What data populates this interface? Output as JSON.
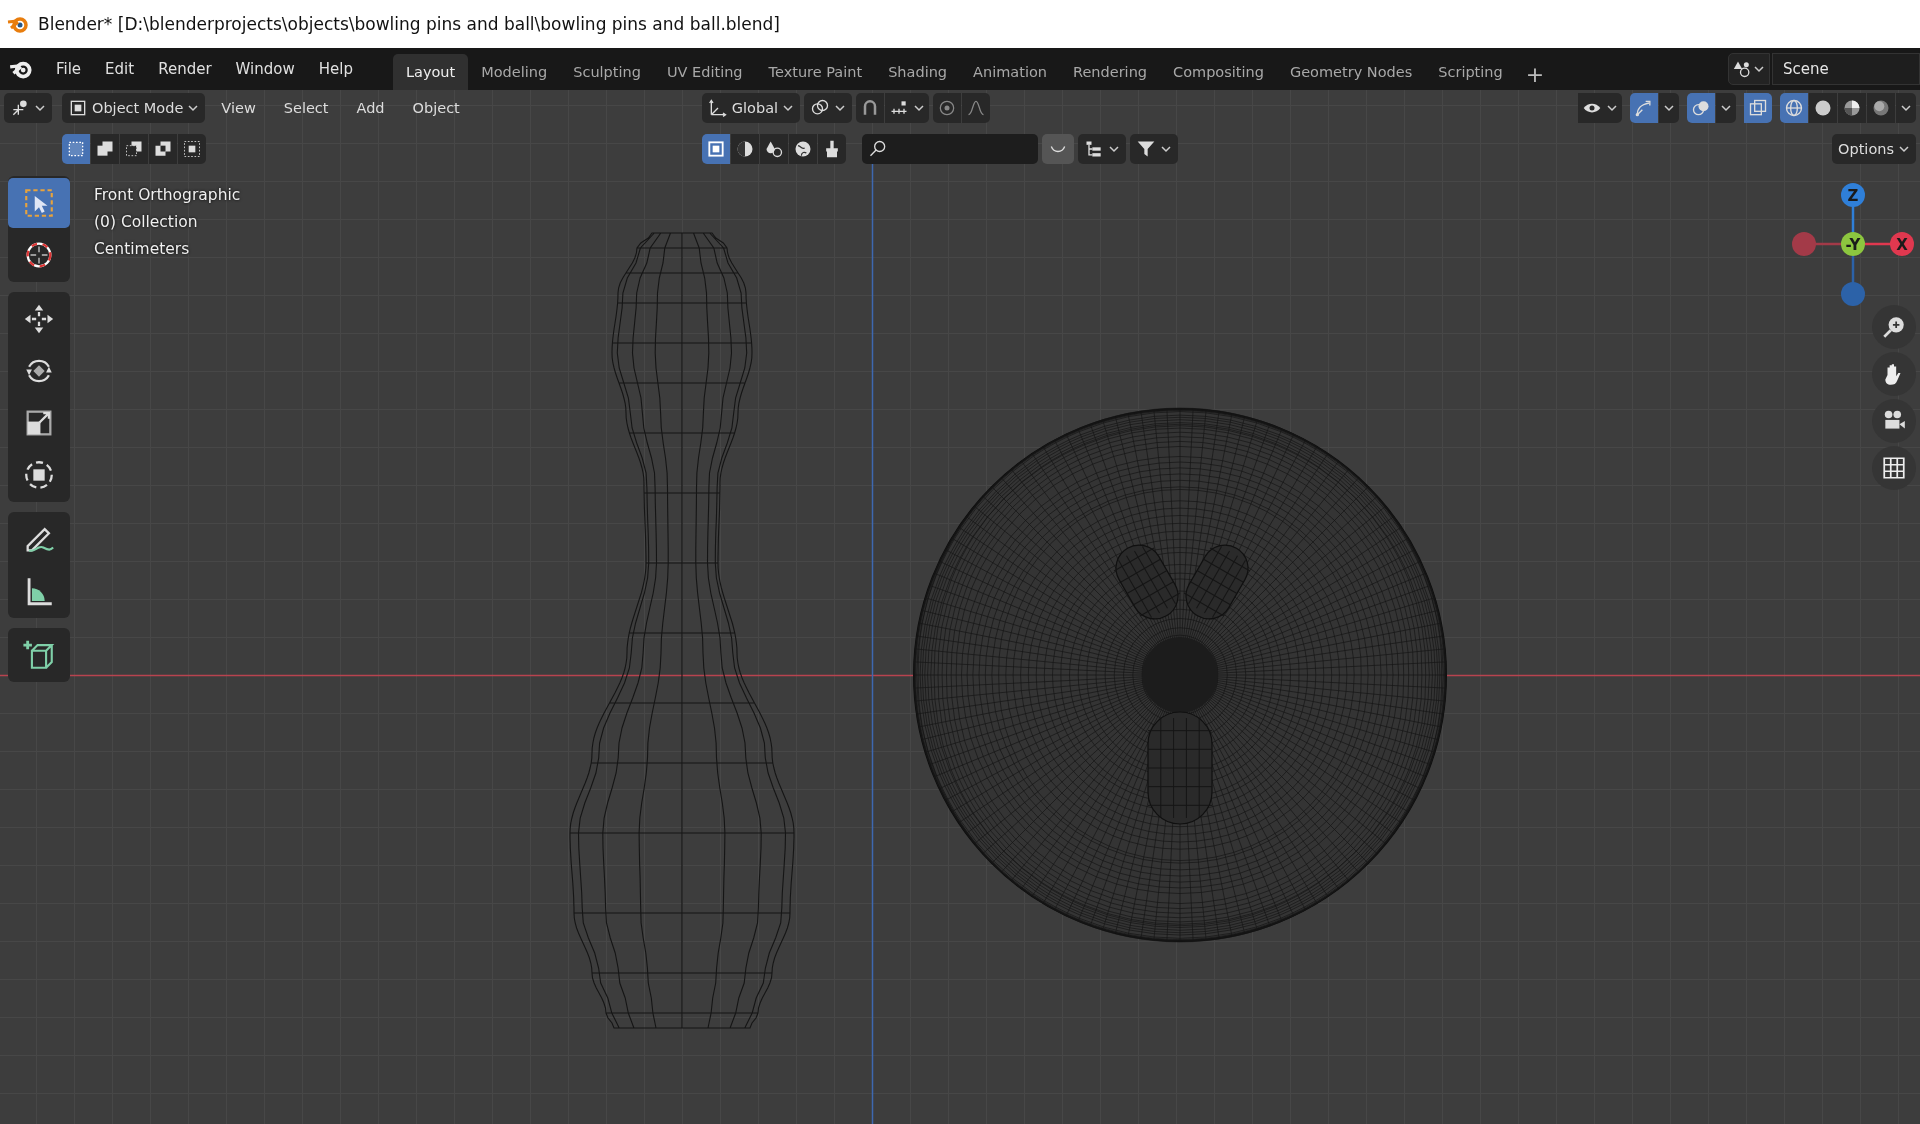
{
  "window": {
    "title": "Blender* [D:\\blenderprojects\\objects\\bowling pins and ball\\bowling pins and ball.blend]"
  },
  "menu_bar": {
    "menus": [
      "File",
      "Edit",
      "Render",
      "Window",
      "Help"
    ],
    "workspaces": [
      {
        "label": "Layout",
        "selected": true
      },
      {
        "label": "Modeling",
        "selected": false
      },
      {
        "label": "Sculpting",
        "selected": false
      },
      {
        "label": "UV Editing",
        "selected": false
      },
      {
        "label": "Texture Paint",
        "selected": false
      },
      {
        "label": "Shading",
        "selected": false
      },
      {
        "label": "Animation",
        "selected": false
      },
      {
        "label": "Rendering",
        "selected": false
      },
      {
        "label": "Compositing",
        "selected": false
      },
      {
        "label": "Geometry Nodes",
        "selected": false
      },
      {
        "label": "Scripting",
        "selected": false
      }
    ],
    "add_workspace": "+",
    "scene": "Scene"
  },
  "viewport_header": {
    "mode": "Object Mode",
    "menus": [
      "View",
      "Select",
      "Add",
      "Object"
    ],
    "orientation": "Global",
    "overlays": [
      {
        "kind": "visibility",
        "on": false
      },
      {
        "kind": "gizmos",
        "on": true
      },
      {
        "kind": "overlays",
        "on": true
      },
      {
        "kind": "xray",
        "on": true
      }
    ],
    "shading": [
      {
        "kind": "wireframe",
        "selected": true
      },
      {
        "kind": "solid",
        "selected": false
      },
      {
        "kind": "material",
        "selected": false
      },
      {
        "kind": "rendered",
        "selected": false
      }
    ]
  },
  "tool_header": {
    "select_modes": [
      {
        "kind": "set",
        "selected": true
      },
      {
        "kind": "extend",
        "selected": false
      },
      {
        "kind": "subtract",
        "selected": false
      },
      {
        "kind": "difference",
        "selected": false
      },
      {
        "kind": "intersect",
        "selected": false
      }
    ],
    "filters": [
      {
        "kind": "mesh",
        "selected": true
      },
      {
        "kind": "shade",
        "selected": false
      },
      {
        "kind": "drops",
        "selected": false
      },
      {
        "kind": "globe",
        "selected": false
      },
      {
        "kind": "brush",
        "selected": false
      }
    ],
    "options": "Options"
  },
  "viewport": {
    "info": [
      "Front Orthographic",
      "(0) Collection",
      "Centimeters"
    ]
  },
  "toolbar": [
    {
      "tools": [
        {
          "kind": "select_box",
          "selected": true
        },
        {
          "kind": "cursor",
          "selected": false
        }
      ]
    },
    {
      "tools": [
        {
          "kind": "move",
          "selected": false
        },
        {
          "kind": "rotate",
          "selected": false
        },
        {
          "kind": "scale",
          "selected": false
        },
        {
          "kind": "transform",
          "selected": false
        }
      ]
    },
    {
      "tools": [
        {
          "kind": "annotate",
          "selected": false
        },
        {
          "kind": "measure",
          "selected": false
        }
      ]
    },
    {
      "tools": [
        {
          "kind": "add_cube",
          "selected": false
        }
      ]
    }
  ],
  "gizmo": {
    "axes": [
      {
        "label": "Z",
        "color": "#2f7fd8",
        "kind": "top"
      },
      {
        "kind": "left",
        "color": "#a33a48"
      },
      {
        "label": "X",
        "color": "#e0384f",
        "kind": "right"
      },
      {
        "kind": "bottom",
        "color": "#2c62a8"
      },
      {
        "label": "-Y",
        "color": "#8cc63f",
        "kind": "center"
      }
    ]
  },
  "navigation": [
    {
      "kind": "zoom"
    },
    {
      "kind": "pan"
    },
    {
      "kind": "camera"
    },
    {
      "kind": "grid"
    }
  ]
}
